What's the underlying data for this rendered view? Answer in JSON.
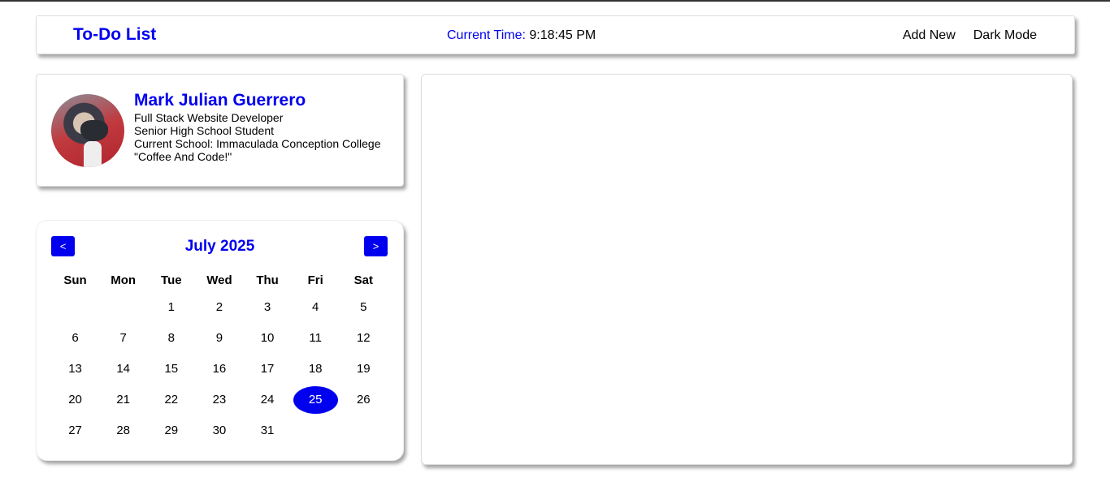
{
  "header": {
    "title": "To-Do List",
    "time_label": "Current Time:",
    "time_value": "9:18:45 PM",
    "nav": [
      "Add New",
      "Dark Mode"
    ]
  },
  "profile": {
    "name": "Mark Julian Guerrero",
    "lines": [
      "Full Stack Website Developer",
      "Senior High School Student",
      "Current School: Immaculada Conception College",
      "\"Coffee And Code!\""
    ]
  },
  "calendar": {
    "month_label": "July 2025",
    "prev_label": "<",
    "next_label": ">",
    "weekdays": [
      "Sun",
      "Mon",
      "Tue",
      "Wed",
      "Thu",
      "Fri",
      "Sat"
    ],
    "weeks": [
      [
        "",
        "",
        "1",
        "2",
        "3",
        "4",
        "5"
      ],
      [
        "6",
        "7",
        "8",
        "9",
        "10",
        "11",
        "12"
      ],
      [
        "13",
        "14",
        "15",
        "16",
        "17",
        "18",
        "19"
      ],
      [
        "20",
        "21",
        "22",
        "23",
        "24",
        "25",
        "26"
      ],
      [
        "27",
        "28",
        "29",
        "30",
        "31",
        "",
        ""
      ]
    ],
    "selected_day": "25"
  },
  "colors": {
    "accent": "#0000ee"
  }
}
